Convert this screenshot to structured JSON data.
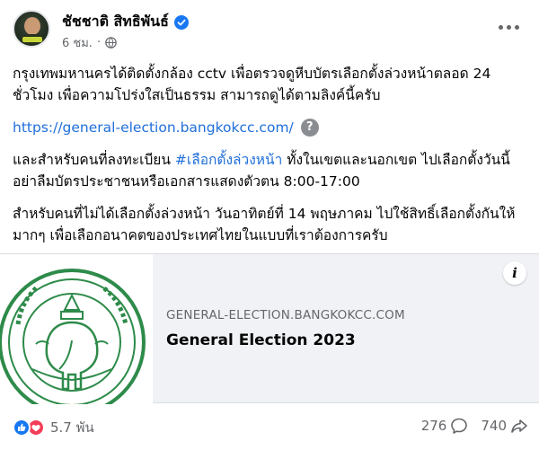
{
  "post": {
    "author": "ชัชชาติ สิทธิพันธ์",
    "time": "6 ชม.",
    "separator": "·",
    "paragraph1": "กรุงเทพมหานครได้ติดตั้งกล้อง cctv เพื่อตรวจดูหีบบัตรเลือกตั้งล่วงหน้าตลอด 24 ชั่วโมง เพื่อความโปร่งใสเป็นธรรม สามารถดูได้ตามลิงค์นี้ครับ",
    "link": "https://general-election.bangkokcc.com/",
    "help_glyph": "?",
    "paragraph2_before": "และสำหรับคนที่ลงทะเบียน ",
    "hashtag": "#เลือกตั้งล่วงหน้า",
    "paragraph2_after": " ทั้งในเขตและนอกเขต ไปเลือกตั้งวันนี้อย่าลืมบัตรประชาชนหรือเอกสารแสดงตัวตน 8:00-17:00",
    "paragraph3": "สำหรับคนที่ไม่ได้เลือกตั้งล่วงหน้า วันอาทิตย์ที่ 14 พฤษภาคม ไปใช้สิทธิ์เลือกตั้งกันให้มากๆ เพื่อเลือกอนาคตของประเทศไทยในแบบที่เราต้องการครับ"
  },
  "card": {
    "domain": "GENERAL-ELECTION.BANGKOKCC.COM",
    "title": "General Election 2023",
    "info_glyph": "i"
  },
  "footer": {
    "reactions": "5.7 พัน",
    "comments": "276",
    "shares": "740"
  },
  "colors": {
    "link": "#216fdb",
    "seal": "#2e8b4a",
    "like": "#1877f2",
    "love": "#f33e58"
  },
  "icons": [
    "verified-icon",
    "globe-icon",
    "more-icon",
    "help-icon",
    "info-icon",
    "like-icon",
    "love-icon",
    "comment-icon",
    "share-icon"
  ]
}
